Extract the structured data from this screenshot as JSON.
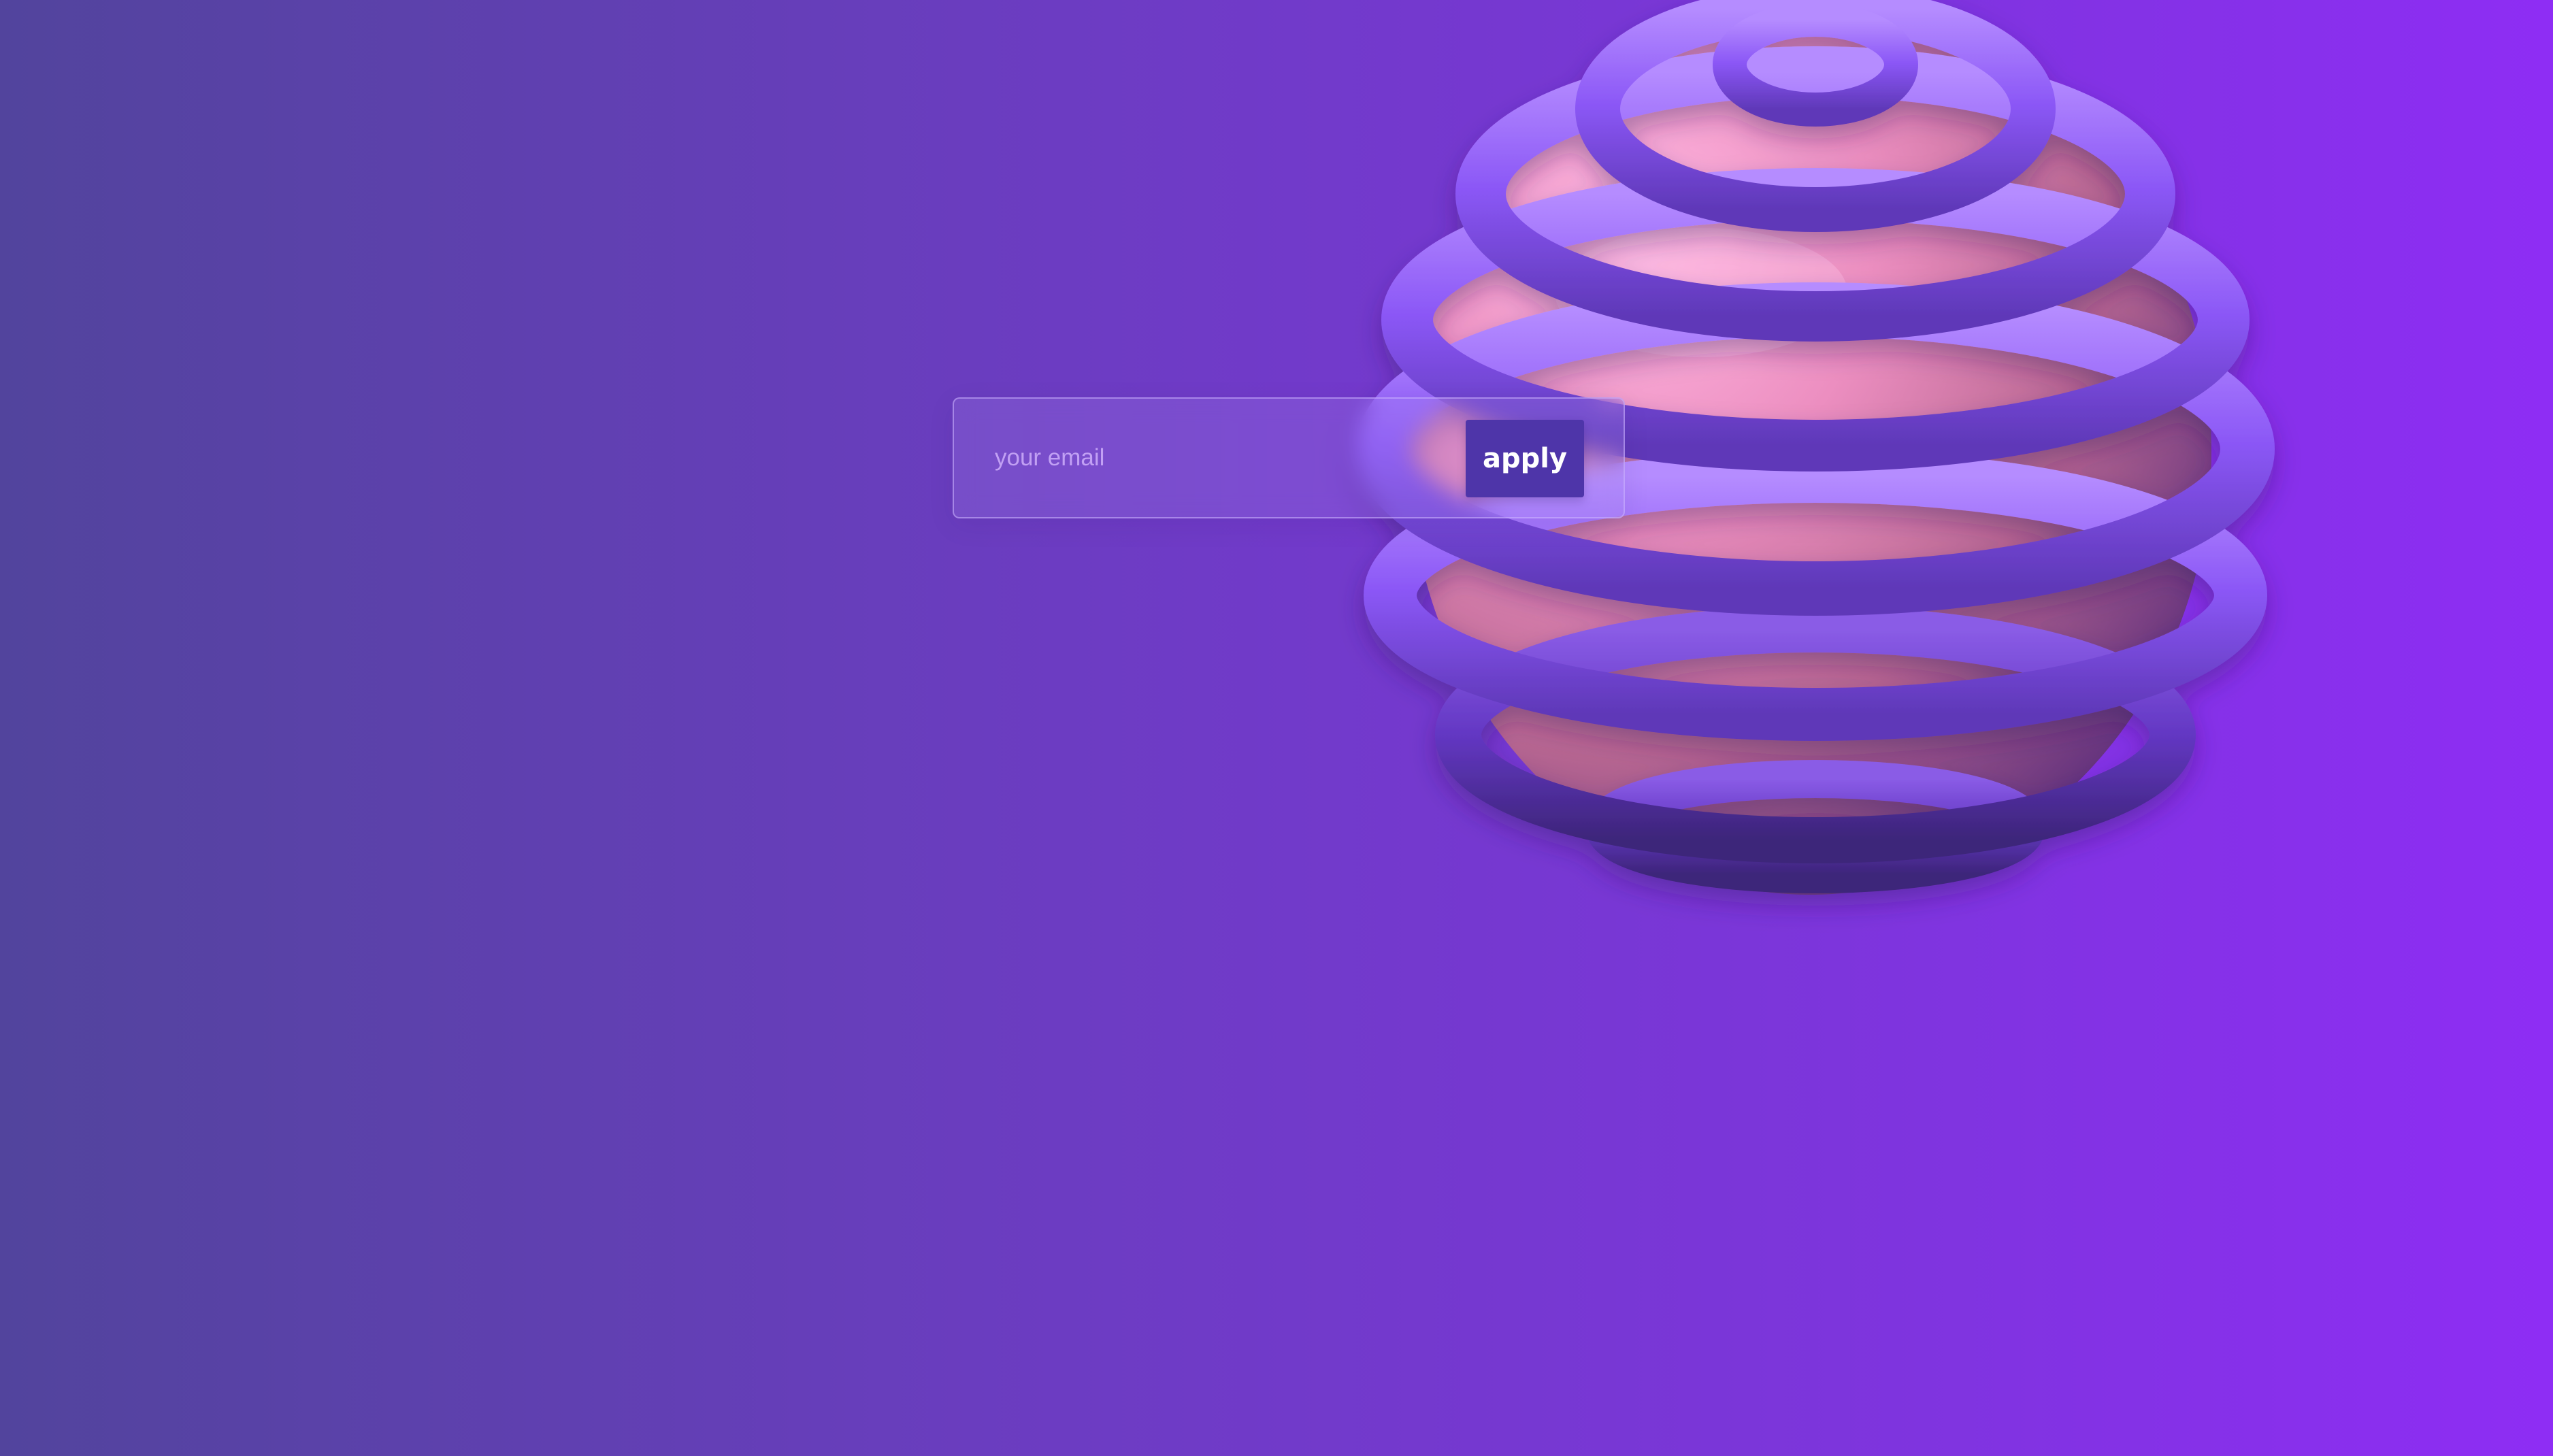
{
  "signup": {
    "email_placeholder": "your email",
    "apply_label": "apply"
  },
  "colors": {
    "background_left": "#52449d",
    "background_right": "#8e2df4",
    "button": "#4e35a9",
    "ring": "#8757f7",
    "sphere": "#e98ab7"
  },
  "graphic": {
    "shape": "pink sphere wrapped in purple rings"
  }
}
